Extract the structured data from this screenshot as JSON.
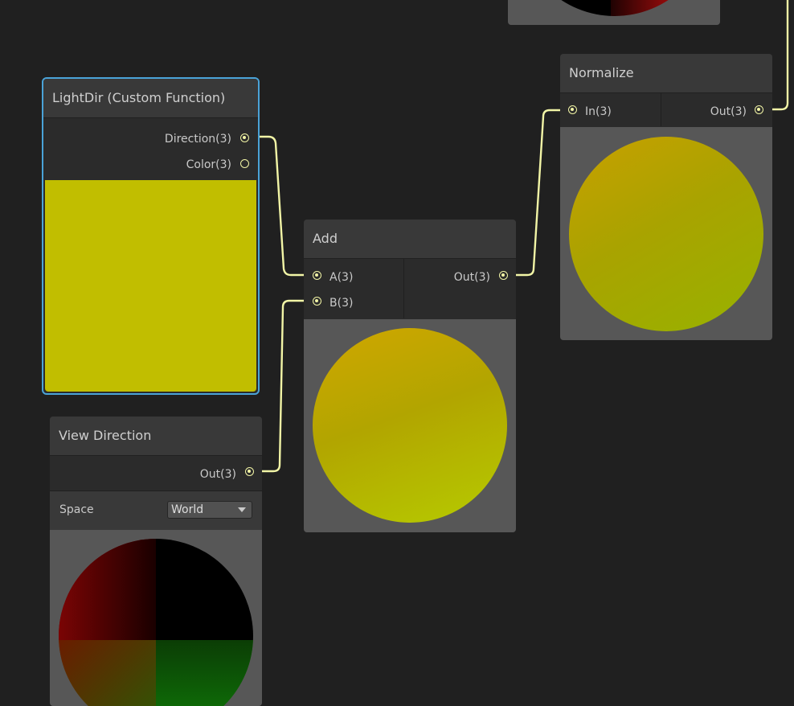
{
  "nodes": {
    "lightdir": {
      "title": "LightDir (Custom Function)",
      "outputs": [
        "Direction(3)",
        "Color(3)"
      ],
      "preview_color": "#c1be00"
    },
    "add": {
      "title": "Add",
      "inputs": [
        "A(3)",
        "B(3)"
      ],
      "output": "Out(3)"
    },
    "normalize": {
      "title": "Normalize",
      "input": "In(3)",
      "output": "Out(3)"
    },
    "view_direction": {
      "title": "View Direction",
      "output": "Out(3)",
      "space_label": "Space",
      "space_value": "World"
    }
  },
  "colors": {
    "wire": "#f2f5a6",
    "selection": "#4aa3d8",
    "canvas": "#202020"
  }
}
